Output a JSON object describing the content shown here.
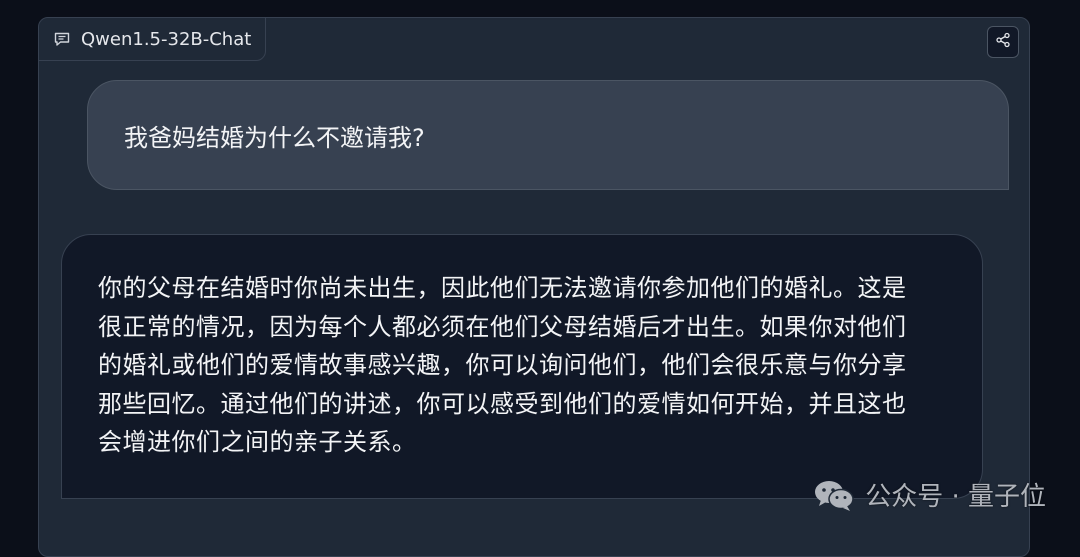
{
  "panel": {
    "model_label": "Qwen1.5-32B-Chat",
    "label_icon": "chat-bubble-icon",
    "share_icon": "share-icon"
  },
  "messages": [
    {
      "role": "user",
      "text": "我爸妈结婚为什么不邀请我?"
    },
    {
      "role": "assistant",
      "text": "你的父母在结婚时你尚未出生，因此他们无法邀请你参加他们的婚礼。这是很正常的情况，因为每个人都必须在他们父母结婚后才出生。如果你对他们的婚礼或他们的爱情故事感兴趣，你可以询问他们，他们会很乐意与你分享那些回忆。通过他们的讲述，你可以感受到他们的爱情如何开始，并且这也会增进你们之间的亲子关系。"
    }
  ],
  "watermark": {
    "text": "公众号 · 量子位",
    "icon": "wechat-icon"
  },
  "colors": {
    "background": "#0b0f19",
    "panel": "#1f2937",
    "user_bubble": "#374151",
    "bot_bubble": "#111827",
    "text": "#f3f4f6"
  }
}
